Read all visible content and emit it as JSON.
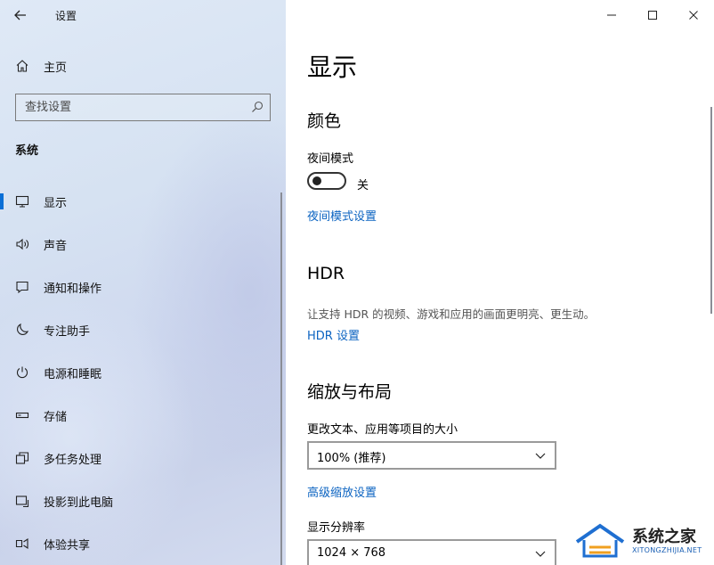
{
  "window": {
    "title": "设置",
    "controls": [
      "minimize-icon",
      "maximize-icon",
      "close-icon"
    ]
  },
  "sidebar": {
    "home_label": "主页",
    "search_placeholder": "查找设置",
    "section_title": "系统",
    "items": [
      {
        "label": "显示",
        "icon": "monitor-icon",
        "selected": true
      },
      {
        "label": "声音",
        "icon": "speaker-icon",
        "selected": false
      },
      {
        "label": "通知和操作",
        "icon": "notification-icon",
        "selected": false
      },
      {
        "label": "专注助手",
        "icon": "moon-icon",
        "selected": false
      },
      {
        "label": "电源和睡眠",
        "icon": "power-icon",
        "selected": false
      },
      {
        "label": "存储",
        "icon": "storage-icon",
        "selected": false
      },
      {
        "label": "多任务处理",
        "icon": "multitask-icon",
        "selected": false
      },
      {
        "label": "投影到此电脑",
        "icon": "project-icon",
        "selected": false
      },
      {
        "label": "体验共享",
        "icon": "share-icon",
        "selected": false
      }
    ]
  },
  "main": {
    "title": "显示",
    "color": {
      "heading": "颜色",
      "night_light_label": "夜间模式",
      "toggle_state": "关",
      "night_light_link": "夜间模式设置"
    },
    "hdr": {
      "heading": "HDR",
      "description": "让支持 HDR 的视频、游戏和应用的画面更明亮、更生动。",
      "link": "HDR 设置"
    },
    "scale": {
      "heading": "缩放与布局",
      "scale_label": "更改文本、应用等项目的大小",
      "scale_value": "100% (推荐)",
      "advanced_link": "高级缩放设置",
      "resolution_label": "显示分辨率",
      "resolution_value": "1024 × 768"
    }
  },
  "watermark": {
    "name": "系统之家",
    "url": "XITONGZHIJIA.NET"
  },
  "colors": {
    "accent": "#0a6fd6",
    "link": "#0b63c1"
  }
}
